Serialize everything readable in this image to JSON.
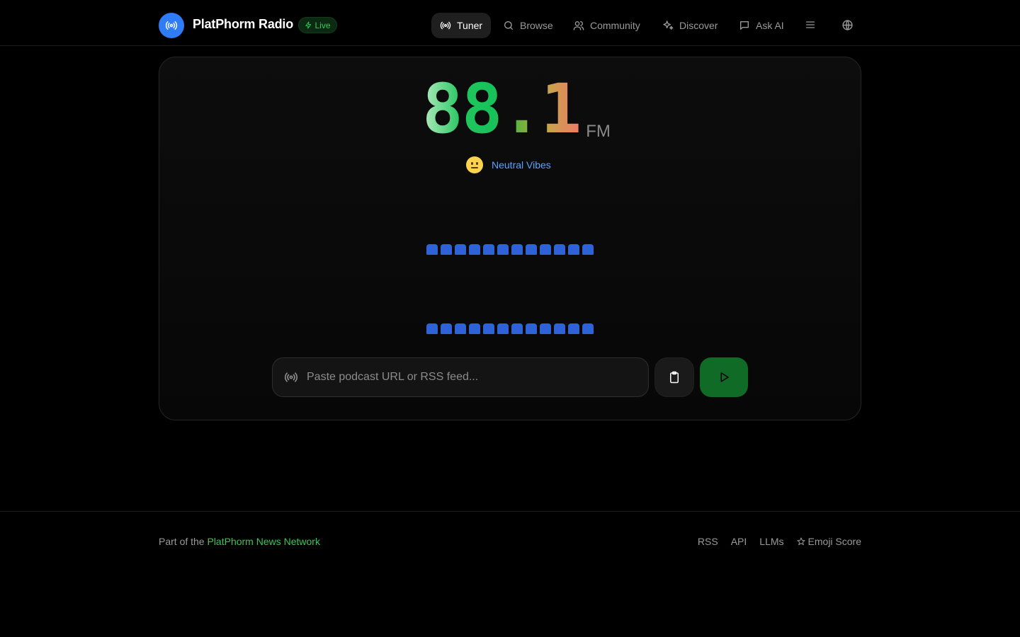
{
  "brand": {
    "name": "PlatPhorm Radio",
    "live_label": "Live"
  },
  "nav": {
    "tuner": "Tuner",
    "browse": "Browse",
    "community": "Community",
    "discover": "Discover",
    "ask_ai": "Ask AI"
  },
  "tuner": {
    "frequency": "88.1",
    "unit": "FM",
    "mood_label": "Neutral Vibes",
    "mood_icon": "neutral-face-emoji",
    "bar_count": 12
  },
  "input": {
    "placeholder": "Paste podcast URL or RSS feed..."
  },
  "footer": {
    "prefix": "Part of the ",
    "network_link": "PlatPhorm News Network",
    "links": [
      "RSS",
      "API",
      "LLMs",
      "Emoji Score"
    ]
  },
  "colors": {
    "accent_blue": "#2f7cf6",
    "live_green": "#35c759",
    "play_green": "#0f6b26",
    "bar_blue": "#2d63d6",
    "mood_blue": "#5aa2ff"
  }
}
